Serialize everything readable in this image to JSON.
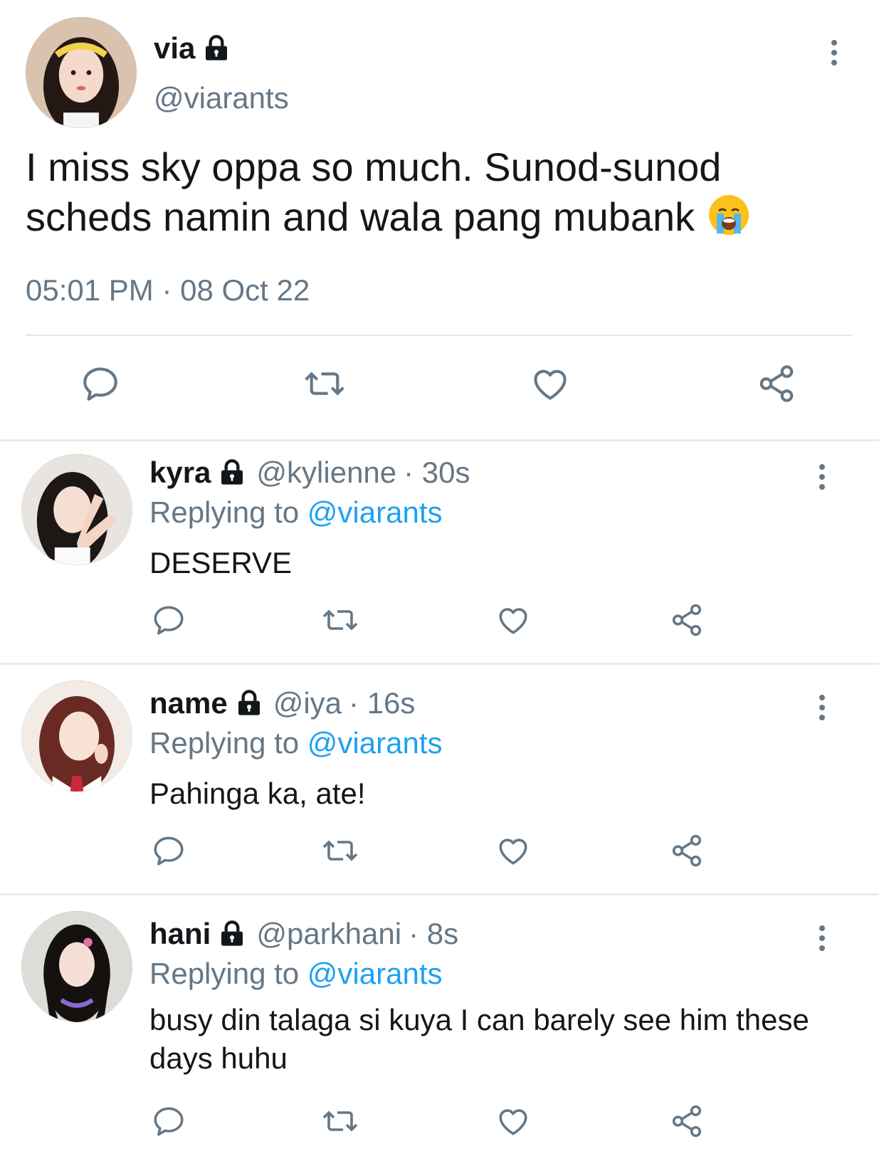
{
  "main_tweet": {
    "display_name": "via",
    "handle": "@viarants",
    "text": "I miss sky oppa so much. Sunod-sunod scheds namin and wala pang mubank",
    "emoji": "loudly-crying-face",
    "timestamp": "05:01 PM · 08 Oct 22",
    "locked": true
  },
  "actions": {
    "reply_icon": "speech-bubble-icon",
    "retweet_icon": "retweet-icon",
    "like_icon": "heart-icon",
    "share_icon": "share-icon"
  },
  "replies": [
    {
      "display_name": "kyra",
      "handle": "@kylienne",
      "time": "· 30s",
      "replying_prefix": "Replying to",
      "replying_to": "@viarants",
      "text": "DESERVE",
      "locked": true
    },
    {
      "display_name": "name",
      "handle": "@iya",
      "time": "· 16s",
      "replying_prefix": "Replying to",
      "replying_to": "@viarants",
      "text": "Pahinga ka, ate!",
      "locked": true
    },
    {
      "display_name": "hani",
      "handle": "@parkhani",
      "time": "· 8s",
      "replying_prefix": "Replying to",
      "replying_to": "@viarants",
      "text": "busy din talaga si kuya I can barely see him these days huhu",
      "locked": true
    }
  ],
  "colors": {
    "text": "#14171a",
    "secondary": "#657786",
    "accent": "#1da1f2",
    "divider": "#e1e8ed"
  }
}
